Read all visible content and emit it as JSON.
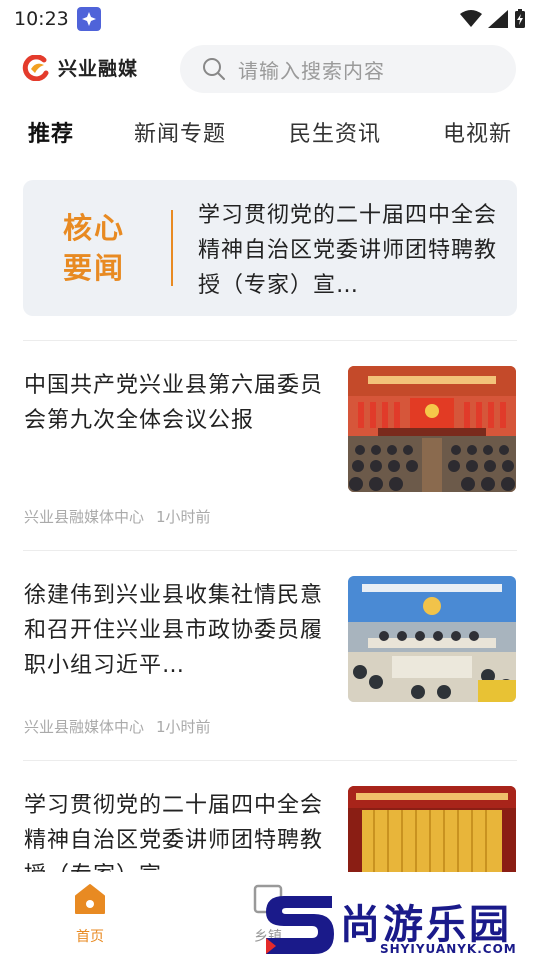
{
  "status_bar": {
    "time": "10:23"
  },
  "header": {
    "app_name": "兴业融媒",
    "search_placeholder": "请输入搜索内容"
  },
  "tabs": [
    {
      "label": "推荐",
      "active": true
    },
    {
      "label": "新闻专题",
      "active": false
    },
    {
      "label": "民生资讯",
      "active": false
    },
    {
      "label": "电视新",
      "active": false
    }
  ],
  "headline": {
    "label_line1": "核心",
    "label_line2": "要闻",
    "text": "学习贯彻党的二十届四中全会精神自治区党委讲师团特聘教授（专家）宣…"
  },
  "news": [
    {
      "title": "中国共产党兴业县第六届委员会第九次全体会议公报",
      "source": "兴业县融媒体中心",
      "time": "1小时前",
      "thumb_banner": "中国共产党兴业县第六届委员会第九次全体会议"
    },
    {
      "title": "徐建伟到兴业县收集社情民意和召开住兴业县市政协委员履职小组习近平…",
      "source": "兴业县融媒体中心",
      "time": "1小时前"
    },
    {
      "title": "学习贯彻党的二十届四中全会精神自治区党委讲师团特聘教授（专家）宣",
      "source": "",
      "time": ""
    }
  ],
  "bottom_nav": [
    {
      "label": "首页",
      "icon": "home-icon",
      "active": true
    },
    {
      "label": "乡镇",
      "icon": "town-icon",
      "active": false
    }
  ],
  "watermark": {
    "text": "尚游乐园",
    "sub": "SHYIYUANYK.COM"
  },
  "colors": {
    "accent": "#e88a22",
    "card_bg": "#eef1f5",
    "search_bg": "#f3f4f6"
  }
}
